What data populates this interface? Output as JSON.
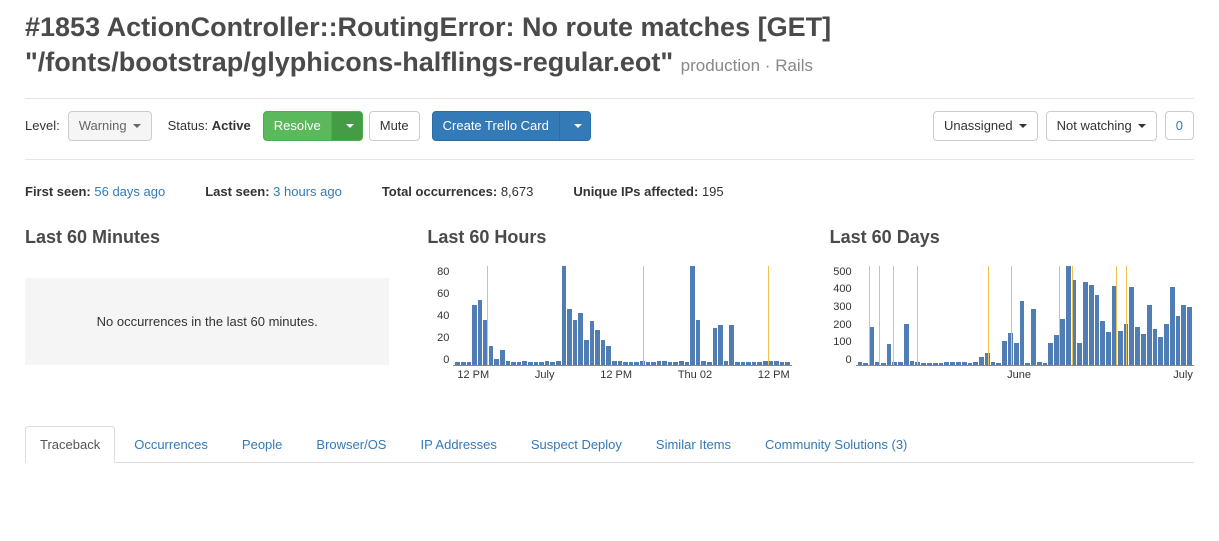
{
  "title": "#1853 ActionController::RoutingError: No route matches [GET] \"/fonts/bootstrap/glyphicons-halflings-regular.eot\"",
  "meta": {
    "env": "production",
    "sep": "·",
    "framework": "Rails"
  },
  "toolbar": {
    "level_label": "Level:",
    "level_value": "Warning",
    "status_label": "Status:",
    "status_value": "Active",
    "resolve": "Resolve",
    "mute": "Mute",
    "trello": "Create Trello Card",
    "assign": "Unassigned",
    "watch": "Not watching",
    "watch_count": "0"
  },
  "stats": {
    "first_seen_label": "First seen:",
    "first_seen_value": "56 days ago",
    "last_seen_label": "Last seen:",
    "last_seen_value": "3 hours ago",
    "total_label": "Total occurrences:",
    "total_value": "8,673",
    "ips_label": "Unique IPs affected:",
    "ips_value": "195"
  },
  "charts": {
    "minutes": {
      "title": "Last 60 Minutes",
      "empty": "No occurrences in the last 60 minutes."
    },
    "hours": {
      "title": "Last 60 Hours"
    },
    "days": {
      "title": "Last 60 Days"
    }
  },
  "tabs": [
    "Traceback",
    "Occurrences",
    "People",
    "Browser/OS",
    "IP Addresses",
    "Suspect Deploy",
    "Similar Items",
    "Community Solutions (3)"
  ],
  "chart_data": [
    {
      "type": "bar",
      "title": "Last 60 Hours",
      "ylim": [
        0,
        80
      ],
      "yticks": [
        0,
        20,
        40,
        60,
        80
      ],
      "xticks": [
        "12 PM",
        "July",
        "12 PM",
        "Thu 02",
        "12 PM"
      ],
      "markers": [
        0.1,
        0.56,
        0.93
      ],
      "values": [
        2,
        2,
        2,
        48,
        52,
        36,
        15,
        5,
        12,
        3,
        2,
        2,
        3,
        2,
        2,
        2,
        3,
        2,
        3,
        83,
        45,
        36,
        42,
        20,
        35,
        28,
        20,
        15,
        3,
        3,
        2,
        2,
        2,
        3,
        2,
        2,
        3,
        3,
        2,
        2,
        3,
        2,
        98,
        36,
        3,
        2,
        30,
        32,
        3,
        32,
        2,
        2,
        2,
        2,
        2,
        3,
        3,
        3,
        2,
        2
      ]
    },
    {
      "type": "bar",
      "title": "Last 60 Days",
      "ylim": [
        0,
        500
      ],
      "yticks": [
        0,
        100,
        200,
        300,
        400,
        500
      ],
      "xticks": [
        "June",
        "July"
      ],
      "xtick_positions": [
        0.52,
        0.97
      ],
      "markers": [
        0.04,
        0.07,
        0.11,
        0.18,
        0.39,
        0.46,
        0.6,
        0.64,
        0.77,
        0.8
      ],
      "values": [
        15,
        10,
        190,
        15,
        10,
        105,
        12,
        15,
        205,
        18,
        12,
        10,
        8,
        10,
        10,
        15,
        15,
        15,
        12,
        10,
        12,
        40,
        60,
        12,
        8,
        120,
        160,
        110,
        320,
        8,
        280,
        12,
        10,
        110,
        150,
        230,
        520,
        430,
        110,
        420,
        405,
        350,
        220,
        165,
        400,
        170,
        205,
        395,
        190,
        155,
        300,
        180,
        140,
        205,
        395,
        245,
        300,
        290
      ]
    }
  ]
}
